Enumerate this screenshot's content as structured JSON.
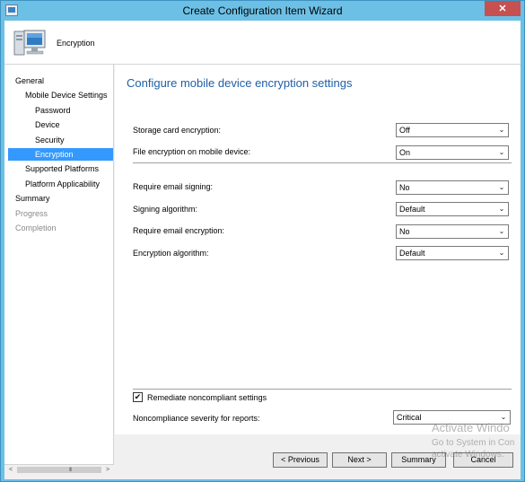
{
  "window": {
    "title": "Create Configuration Item Wizard",
    "minimize_glyph": "—",
    "maximize_glyph": "☐",
    "close_glyph": "✕"
  },
  "header": {
    "title": "Encryption",
    "icon": "computer-icon"
  },
  "nav": {
    "items": [
      {
        "label": "General",
        "state": "normal"
      },
      {
        "label": "Mobile Device Settings",
        "state": "normal"
      },
      {
        "label": "Password",
        "state": "normal"
      },
      {
        "label": "Device",
        "state": "normal"
      },
      {
        "label": "Security",
        "state": "normal"
      },
      {
        "label": "Encryption",
        "state": "selected"
      },
      {
        "label": "Supported Platforms",
        "state": "normal"
      },
      {
        "label": "Platform Applicability",
        "state": "normal"
      },
      {
        "label": "Summary",
        "state": "normal"
      },
      {
        "label": "Progress",
        "state": "disabled"
      },
      {
        "label": "Completion",
        "state": "disabled"
      }
    ],
    "scroll_left": "<",
    "scroll_right": ">",
    "scroll_grip": "III"
  },
  "main": {
    "title": "Configure mobile device encryption settings",
    "settings": [
      {
        "label": "Storage card encryption:",
        "value": "Off"
      },
      {
        "label": "File encryption on mobile device:",
        "value": "On"
      },
      {
        "label": "Require email signing:",
        "value": "No"
      },
      {
        "label": "Signing algorithm:",
        "value": "Default"
      },
      {
        "label": "Require email encryption:",
        "value": "No"
      },
      {
        "label": "Encryption algorithm:",
        "value": "Default"
      }
    ],
    "remediate_label": "Remediate noncompliant settings",
    "remediate_checked": true,
    "check_glyph": "✔",
    "severity_label": "Noncompliance severity for reports:",
    "severity_value": "Critical",
    "dropdown_glyph": "⌄"
  },
  "buttons": {
    "previous": "< Previous",
    "next": "Next >",
    "summary": "Summary",
    "cancel": "Cancel"
  },
  "watermark": {
    "line1": "Activate Windo",
    "line2": "Go to System in Con",
    "line3": "activate Windows."
  },
  "colors": {
    "accent": "#3399ff",
    "title_blue": "#1e5fa6",
    "titlebar": "#6cc0e5"
  }
}
